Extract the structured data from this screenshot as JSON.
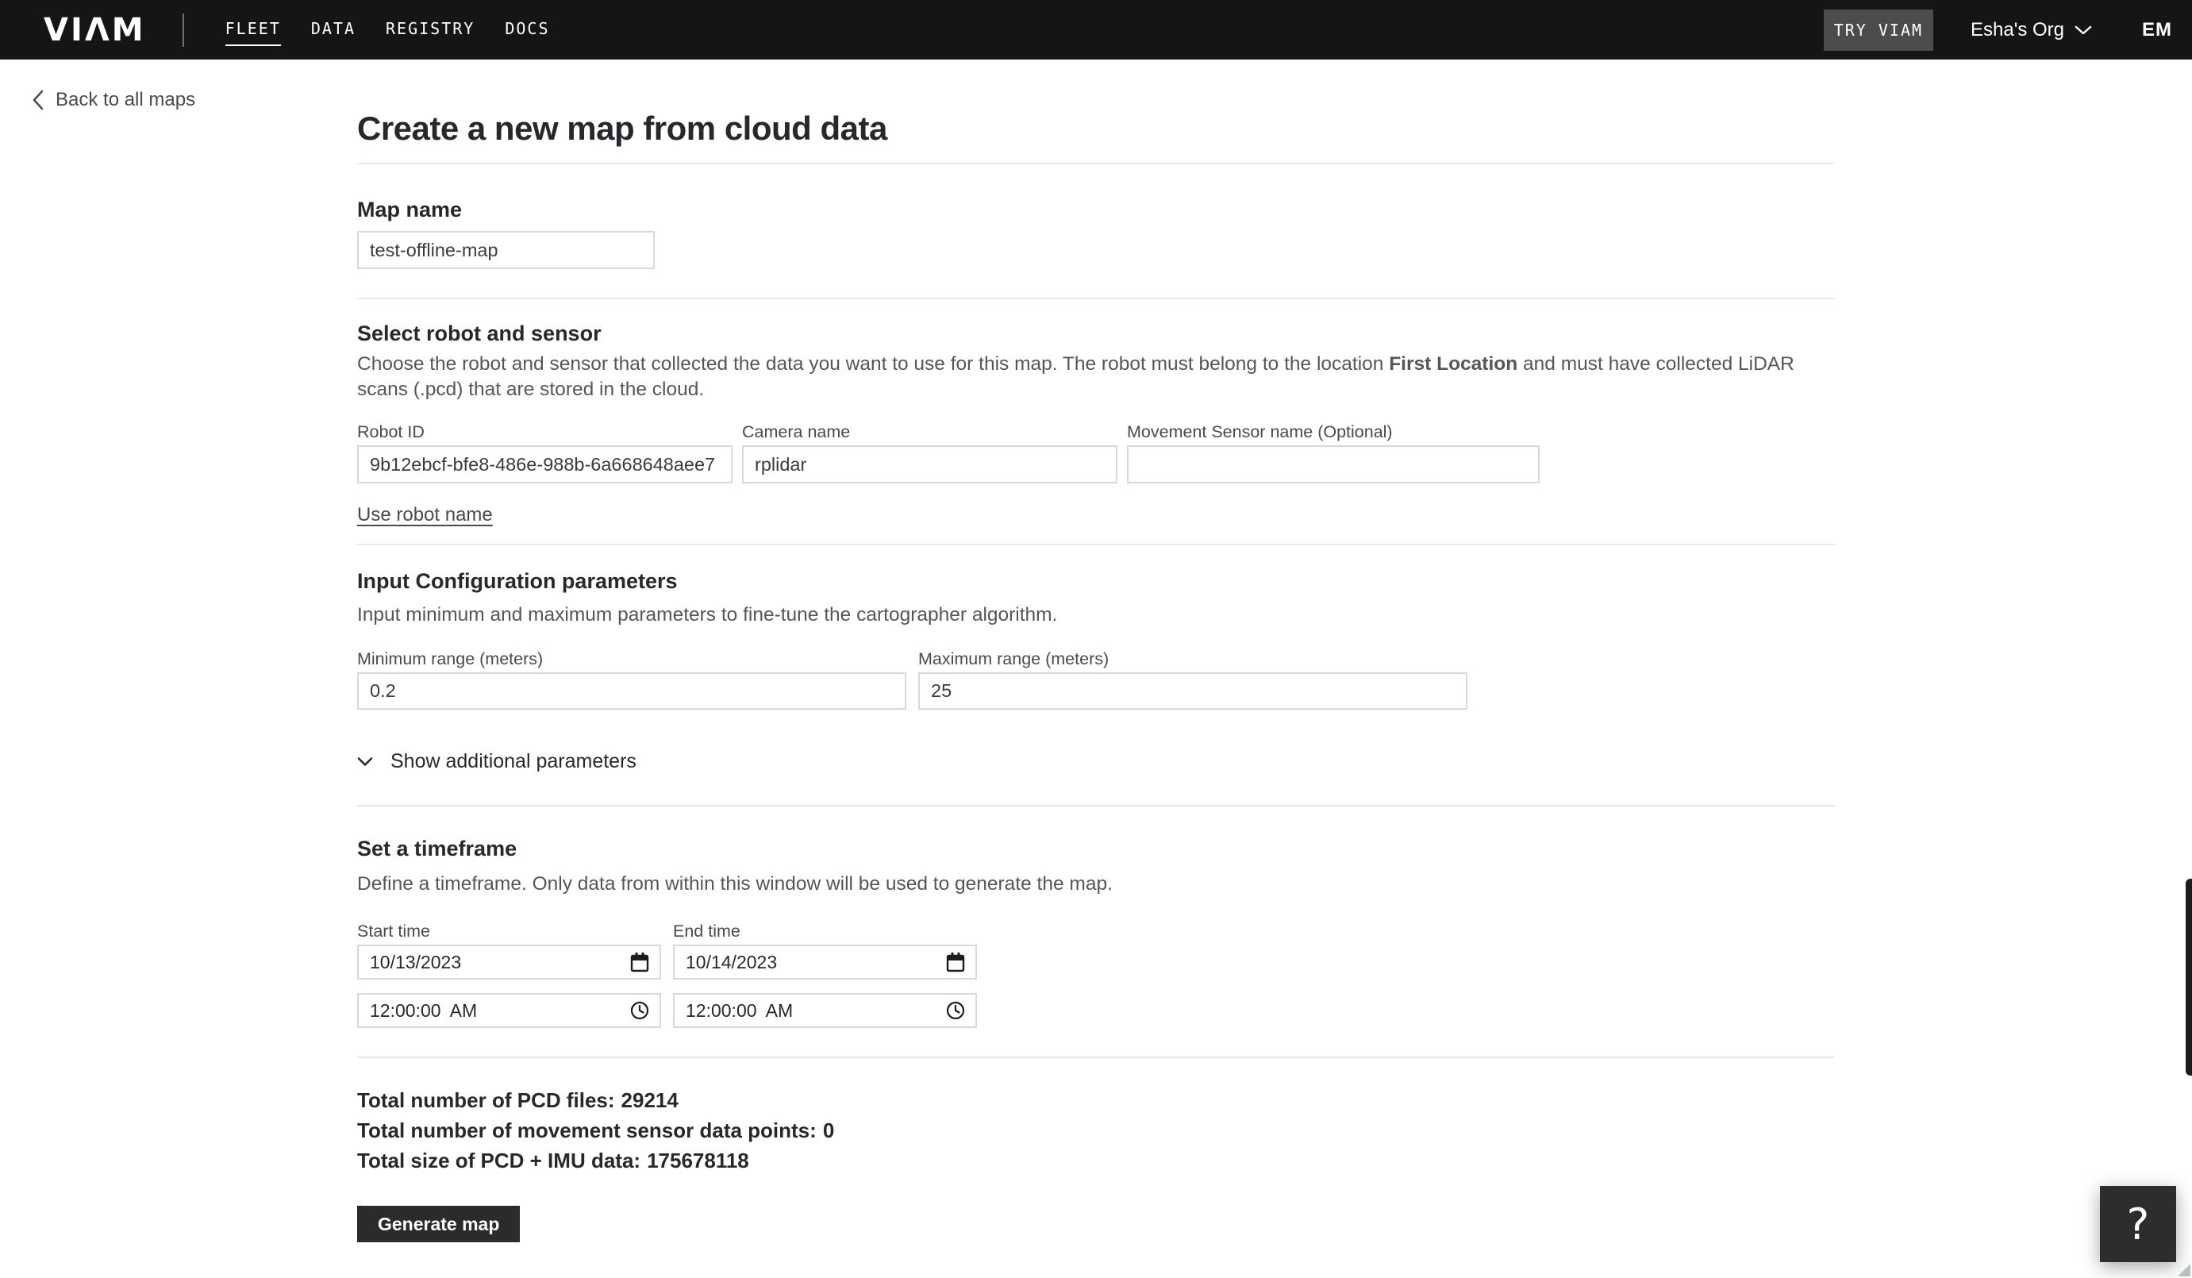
{
  "colors": {
    "nav_bg": "#141515",
    "accent_dark": "#2b2b2c",
    "border": "#d9d9db",
    "text_gray": "#4a4a4b"
  },
  "nav": {
    "logo_text": "VIΛM",
    "items": [
      {
        "label": "FLEET"
      },
      {
        "label": "DATA"
      },
      {
        "label": "REGISTRY"
      },
      {
        "label": "DOCS"
      }
    ],
    "try_viam_label": "TRY VIAM",
    "org_name": "Esha's Org",
    "avatar_initials": "EM"
  },
  "page": {
    "back_label": "Back to all maps",
    "title": "Create a new map from cloud data"
  },
  "map_name_section": {
    "heading": "Map name",
    "value": "test-offline-map"
  },
  "robot_section": {
    "heading": "Select robot and sensor",
    "description": {
      "pre": "Choose the robot and sensor that collected the data you want to use for this map. The robot must belong to the location ",
      "bold": "First Location",
      "post": " and must have collected LiDAR scans (.pcd) that are stored in the cloud."
    },
    "robot_id": {
      "label": "Robot ID",
      "value": "9b12ebcf-bfe8-486e-988b-6a668648aee7"
    },
    "camera": {
      "label": "Camera name",
      "value": "rplidar"
    },
    "movement": {
      "label": "Movement Sensor name (Optional)",
      "value": ""
    },
    "use_robot_name_label": "Use robot name"
  },
  "params_section": {
    "heading": "Input Configuration parameters",
    "description": "Input minimum and maximum parameters to fine-tune the cartographer algorithm.",
    "min": {
      "label": "Minimum range (meters)",
      "value": "0.2"
    },
    "max": {
      "label": "Maximum range (meters)",
      "value": "25"
    },
    "show_additional_label": "Show additional parameters"
  },
  "timeframe_section": {
    "heading": "Set a timeframe",
    "description": "Define a timeframe. Only data from within this window will be used to generate the map.",
    "start": {
      "label": "Start time",
      "date": "10/13/2023",
      "time": "12:00:00 AM"
    },
    "end": {
      "label": "End time",
      "date": "10/14/2023",
      "time": "12:00:00 AM"
    }
  },
  "totals": {
    "items": [
      {
        "label": "Total number of PCD files:",
        "value": "29214"
      },
      {
        "label": "Total number of movement sensor data points:",
        "value": "0"
      },
      {
        "label": "Total size of PCD + IMU data:",
        "value": "175678118"
      }
    ]
  },
  "actions": {
    "generate_label": "Generate map"
  },
  "help": {
    "label": "?"
  }
}
